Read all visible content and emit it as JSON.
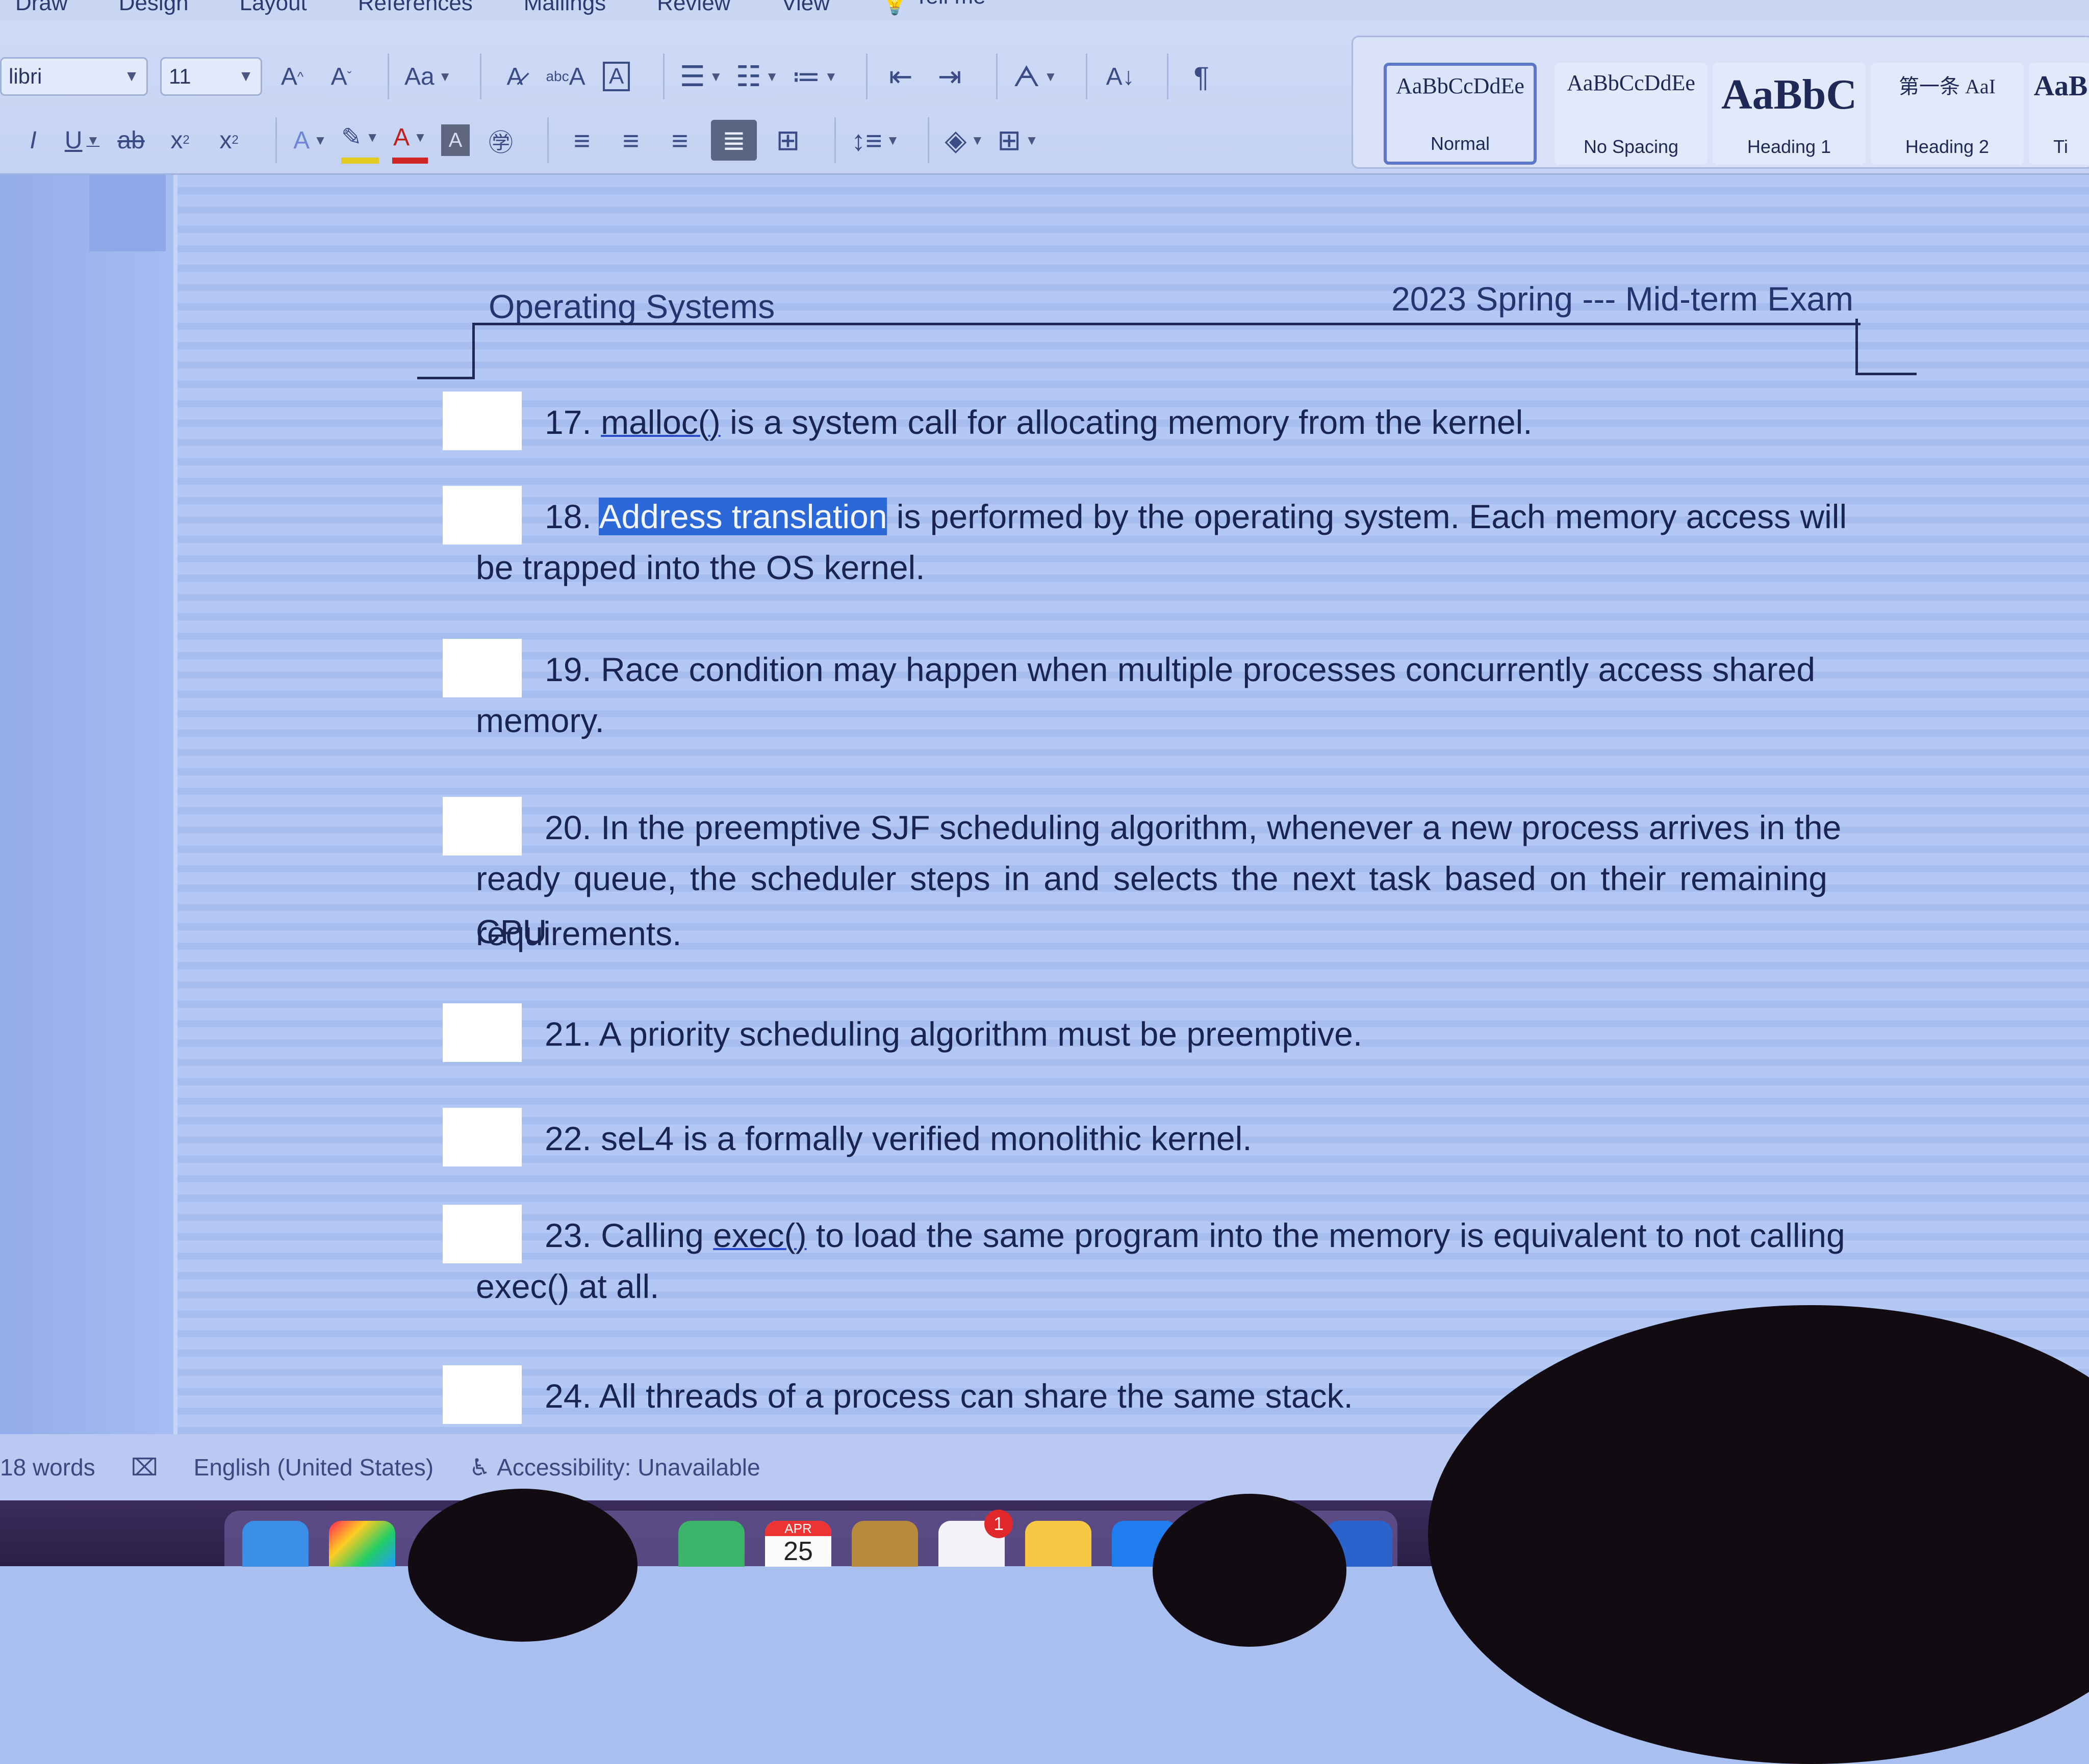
{
  "menu": [
    "Draw",
    "Design",
    "Layout",
    "References",
    "Mailings",
    "Review",
    "View",
    "Tell me"
  ],
  "font": {
    "name": "libri",
    "size": "11"
  },
  "styles": [
    {
      "sample": "AaBbCcDdEe",
      "name": "Normal",
      "selected": true
    },
    {
      "sample": "AaBbCcDdEe",
      "name": "No Spacing",
      "selected": false
    },
    {
      "sample": "AaBbC",
      "name": "Heading 1",
      "selected": false
    },
    {
      "sample": "第一条 AaI",
      "name": "Heading 2",
      "selected": false
    },
    {
      "sample": "AaB",
      "name": "Ti",
      "selected": false
    }
  ],
  "document": {
    "header_left": "Operating Systems",
    "header_right": "2023 Spring --- Mid-term Exam",
    "questions": [
      {
        "num": "17.",
        "underlined": "malloc()",
        "rest": " is a system call for allocating memory from the kernel."
      },
      {
        "num": "18.",
        "selected": "Address translation",
        "line1_rest": " is performed by the operating system. Each memory access will",
        "line2": "be trapped into the OS kernel."
      },
      {
        "num": "19.",
        "line1": "Race condition may happen when multiple processes concurrently access shared",
        "line2": "memory."
      },
      {
        "num": "20.",
        "line1": "In the preemptive SJF scheduling algorithm, whenever a new process arrives in the",
        "line2": "ready queue, the scheduler steps in and selects the next task based on their remaining CPU",
        "line3": "requirements."
      },
      {
        "num": "21.",
        "text": "A priority scheduling algorithm must be preemptive."
      },
      {
        "num": "22.",
        "text": "seL4 is a formally verified monolithic kernel."
      },
      {
        "num": "23.",
        "pre": "Calling ",
        "underlined": "exec()",
        "line1_rest": " to load the same program into the memory is equivalent to not calling",
        "line2": "exec() at all."
      },
      {
        "num": "24.",
        "text": "All threads of a process can share the same stack."
      }
    ]
  },
  "status": {
    "words": "18 words",
    "language": "English (United States)",
    "accessibility": "Accessibility: Unavailable"
  },
  "dock": {
    "calendar_month": "APR",
    "calendar_day": "25",
    "reminders_badge": "1"
  }
}
